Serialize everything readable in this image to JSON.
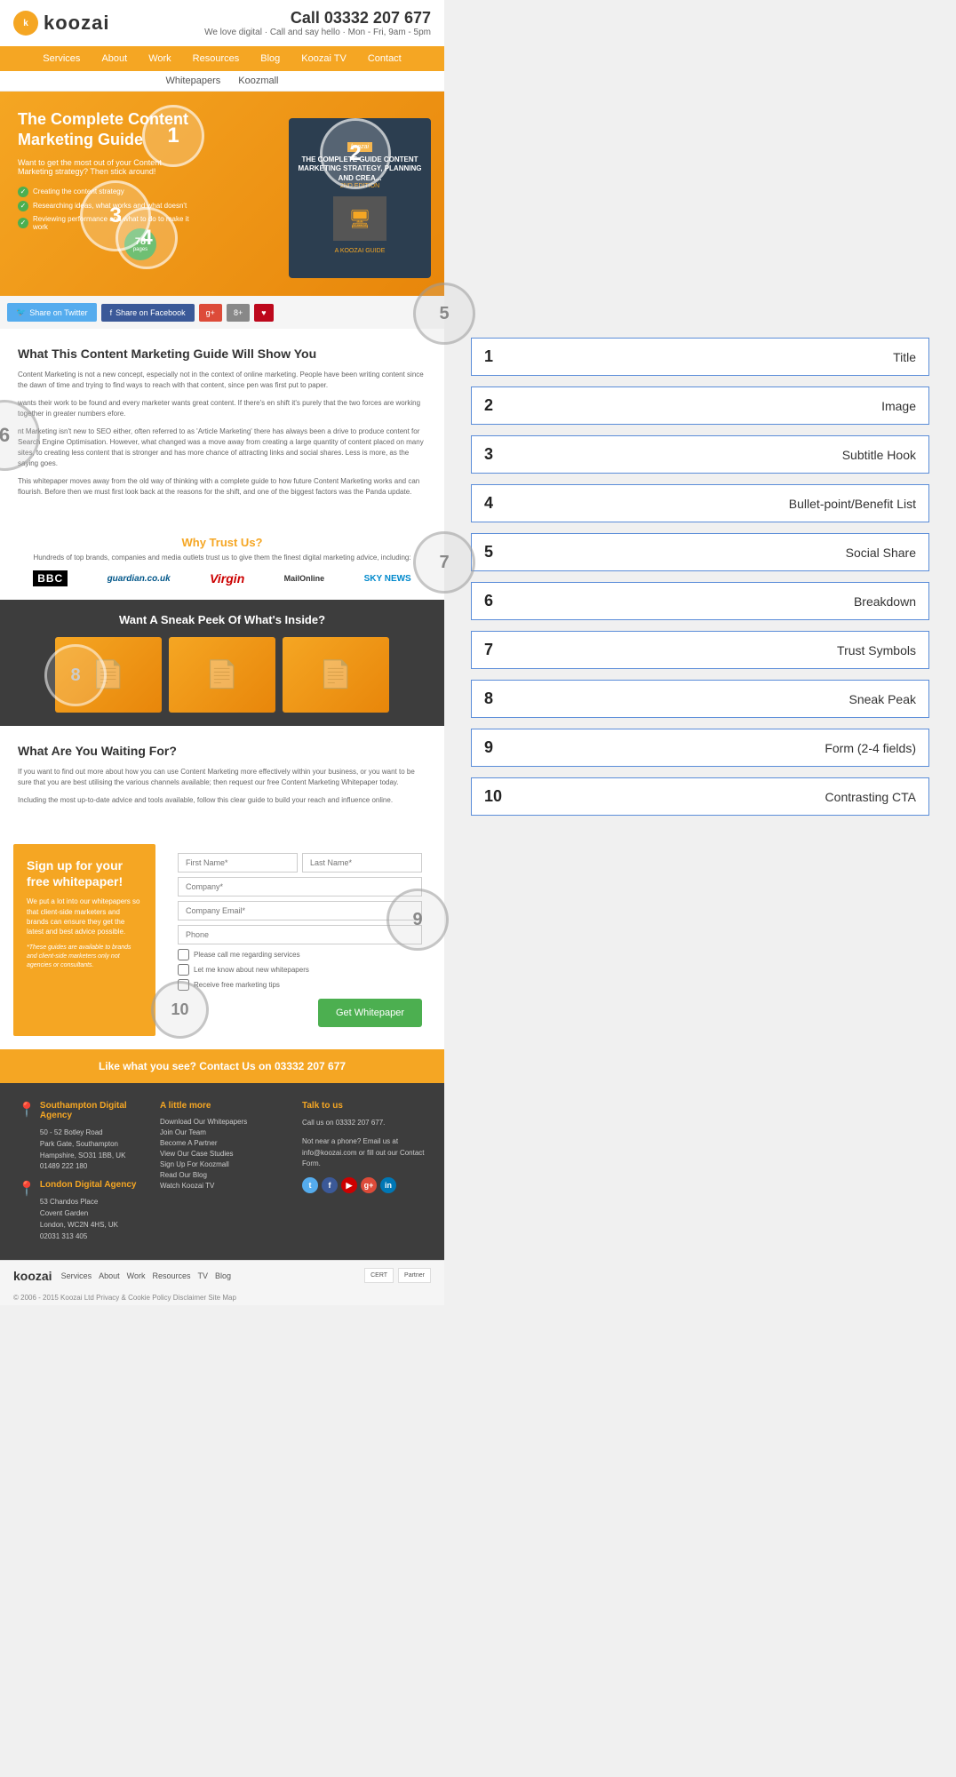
{
  "site": {
    "logo_text": "koozai",
    "phone": "Call 03332 207 677",
    "phone_icon": "ⓘ",
    "phone_sub": "We love digital · Call and say hello · Mon - Fri, 9am - 5pm"
  },
  "nav": {
    "items": [
      "Services",
      "About",
      "Work",
      "Resources",
      "Blog",
      "Koozai TV",
      "Contact"
    ],
    "sub_items": [
      "Whitepapers",
      "Koozmall"
    ]
  },
  "hero": {
    "title": "The Complete Content Marketing Guide",
    "subtitle": "Want to get the most out of your Content Marketing strategy? Then stick around!",
    "bullets": [
      "Creating the content strategy",
      "Researching ideas, what works and what doesn't",
      "Reviewing performance and what to do to make it work"
    ],
    "badge_num": "78",
    "badge_label": "pages",
    "book_title": "THE COMPLETE GUIDE CONTENT MARKETING STRATEGY, PLANNING AND CREA...",
    "book_edition": "2ND EDITION",
    "book_brand": "A KOOZAI GUIDE"
  },
  "social_bar": {
    "twitter_label": "Share on Twitter",
    "facebook_label": "Share on Facebook"
  },
  "content": {
    "section_title": "What This Content Marketing Guide Will Show You",
    "text1": "Content Marketing is not a new concept, especially not in the context of online marketing. People have been writing content since the dawn of time and trying to find ways to reach with that content, since pen was first put to paper.",
    "text2": "wants their work to be found and every marketer wants great content. If there's en shift it's purely that the two forces are working together in greater numbers efore.",
    "text3": "nt Marketing isn't new to SEO either, often referred to as 'Article Marketing' there has always been a drive to produce content for Search Engine Optimisation. However, what changed was a move away from creating a large quantity of content placed on many sites, to creating less content that is stronger and has more chance of attracting links and social shares. Less is more, as the saying goes.",
    "text4": "This whitepaper moves away from the old way of thinking with a complete guide to how future Content Marketing works and can flourish. Before then we must first look back at the reasons for the shift, and one of the biggest factors was the Panda update."
  },
  "trust": {
    "title": "Why Trust Us?",
    "subtitle": "Hundreds of top brands, companies and media outlets trust us to give them the finest digital marketing advice, including:",
    "logos": [
      "BBC",
      "guardian.co.uk",
      "Virgin",
      "MailOnline",
      "SKY NEWS"
    ]
  },
  "sneak": {
    "title": "Want A Sneak Peek Of What's Inside?"
  },
  "waiting": {
    "title": "What Are You Waiting For?",
    "text1": "If you want to find out more about how you can use Content Marketing more effectively within your business, or you want to be sure that you are best utilising the various channels available; then request our free Content Marketing Whitepaper today.",
    "text2": "Including the most up-to-date advice and tools available, follow this clear guide to build your reach and influence online."
  },
  "signup": {
    "title": "Sign up for your free whitepaper!",
    "text": "We put a lot into our whitepapers so that client-side marketers and brands can ensure they get the latest and best advice possible.",
    "disclaimer": "*These guides are available to brands and client-side marketers only not agencies or consultants.",
    "form": {
      "first_name": "First Name*",
      "last_name": "Last Name*",
      "company": "Company*",
      "email": "Company Email*",
      "phone": "Phone",
      "checkbox1": "Please call me regarding services",
      "checkbox2": "Let me know about new whitepapers",
      "checkbox3": "Receive free marketing tips",
      "button": "Get Whitepaper"
    }
  },
  "cta_bar": {
    "text": "Like what you see? Contact Us on 03332 207 677"
  },
  "footer": {
    "col1_title": "Southampton Digital Agency",
    "col1_address1": "50 - 52 Botley Road",
    "col1_address2": "Park Gate, Southampton",
    "col1_address3": "Hampshire, SO31 1BB, UK",
    "col1_phone": "01489 222 180",
    "col1_title2": "London Digital Agency",
    "col1_address4": "53 Chandos Place",
    "col1_address5": "Covent Garden",
    "col1_address6": "London, WC2N 4HS, UK",
    "col1_phone2": "02031 313 405",
    "col2_title": "A little more",
    "col2_links": [
      "Download Our Whitepapers",
      "Join Our Team",
      "Become A Partner",
      "View Our Case Studies",
      "Sign Up For Koozmall",
      "Read Our Blog",
      "Watch Koozai TV"
    ],
    "col3_title": "Talk to us",
    "col3_text": "Call us on 03332 207 677.",
    "col3_email_text": "Not near a phone? Email us at info@koozai.com or fill out our Contact Form."
  },
  "bottom_nav": {
    "logo": "koozai",
    "links": [
      "Services",
      "About",
      "Work",
      "Resources",
      "TV",
      "Blog"
    ],
    "copyright": "© 2006 - 2015 Koozai Ltd  Privacy & Cookie Policy  Disclaimer  Site Map"
  },
  "annotations": [
    {
      "number": "1",
      "label": "Title"
    },
    {
      "number": "2",
      "label": "Image"
    },
    {
      "number": "3",
      "label": "Subtitle Hook"
    },
    {
      "number": "4",
      "label": "Bullet-point/Benefit List"
    },
    {
      "number": "5",
      "label": "Social Share"
    },
    {
      "number": "6",
      "label": "Breakdown"
    },
    {
      "number": "7",
      "label": "Trust Symbols"
    },
    {
      "number": "8",
      "label": "Sneak Peak"
    },
    {
      "number": "9",
      "label": "Form (2-4 fields)"
    },
    {
      "number": "10",
      "label": "Contrasting CTA"
    }
  ],
  "colors": {
    "orange": "#f5a623",
    "dark": "#3d3d3d",
    "blue_annotation": "#5b8dd9",
    "green": "#4caf50"
  }
}
